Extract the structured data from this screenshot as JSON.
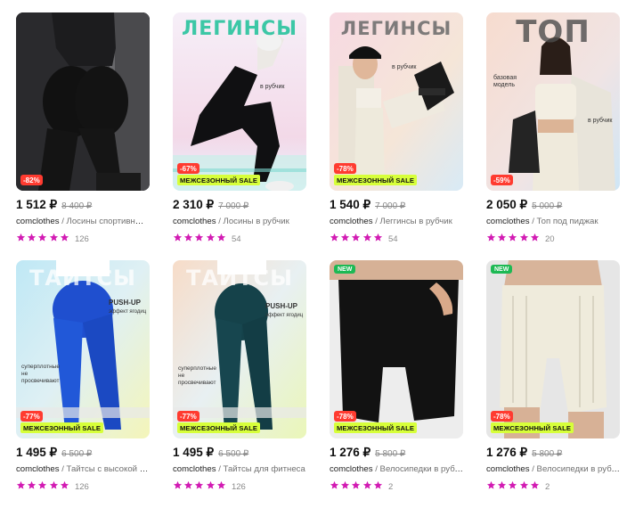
{
  "currency": "₽",
  "colors": {
    "accent_star": "#d21bb3",
    "discount_badge": "#ff3b30",
    "sale_badge": "#d7ff3a",
    "new_badge": "#1db954"
  },
  "products": [
    {
      "price": "1 512 ₽",
      "old_price": "8 400 ₽",
      "brand": "comclothes",
      "category": "Лосины спортивные т...",
      "reviews": "126",
      "discount": "-82%",
      "sale_label": "",
      "new_label": "",
      "banner_title": "",
      "banner_sub": "",
      "rating": 5
    },
    {
      "price": "2 310 ₽",
      "old_price": "7 000 ₽",
      "brand": "comclothes",
      "category": "Лосины в рубчик",
      "reviews": "54",
      "discount": "-67%",
      "sale_label": "МЕЖСЕЗОННЫЙ SALE",
      "new_label": "",
      "banner_title": "ЛЕГИНСЫ",
      "banner_sub": "в рубчик",
      "rating": 5
    },
    {
      "price": "1 540 ₽",
      "old_price": "7 000 ₽",
      "brand": "comclothes",
      "category": "Леггинсы в рубчик",
      "reviews": "54",
      "discount": "-78%",
      "sale_label": "МЕЖСЕЗОННЫЙ SALE",
      "new_label": "",
      "banner_title": "ЛЕГИНСЫ",
      "banner_sub": "в рубчик",
      "rating": 5
    },
    {
      "price": "2 050 ₽",
      "old_price": "5 000 ₽",
      "brand": "comclothes",
      "category": "Топ под пиджак",
      "reviews": "20",
      "discount": "-59%",
      "sale_label": "",
      "new_label": "",
      "banner_title": "ТОП",
      "banner_sub": "базовая модель",
      "banner_sub2": "в рубчик",
      "rating": 5
    },
    {
      "price": "1 495 ₽",
      "old_price": "6 500 ₽",
      "brand": "comclothes",
      "category": "Тайтсы с высокой тал...",
      "reviews": "126",
      "discount": "-77%",
      "sale_label": "МЕЖСЕЗОННЫЙ SALE",
      "new_label": "",
      "banner_title": "ТАЙТСЫ",
      "banner_sub": "PUSH-UP",
      "banner_sub2": "эффект ягодиц",
      "banner_sub3": "суперплотные не просвечивают",
      "rating": 5
    },
    {
      "price": "1 495 ₽",
      "old_price": "6 500 ₽",
      "brand": "comclothes",
      "category": "Тайтсы для фитнеса",
      "reviews": "126",
      "discount": "-77%",
      "sale_label": "МЕЖСЕЗОННЫЙ SALE",
      "new_label": "",
      "banner_title": "ТАЙТСЫ",
      "banner_sub": "PUSH-UP",
      "banner_sub2": "эффект ягодиц",
      "banner_sub3": "суперплотные не просвечивают",
      "rating": 5
    },
    {
      "price": "1 276 ₽",
      "old_price": "5 800 ₽",
      "brand": "comclothes",
      "category": "Велосипедки в рубчик...",
      "reviews": "2",
      "discount": "-78%",
      "sale_label": "МЕЖСЕЗОННЫЙ SALE",
      "new_label": "NEW",
      "banner_title": "",
      "banner_sub": "",
      "rating": 5
    },
    {
      "price": "1 276 ₽",
      "old_price": "5 800 ₽",
      "brand": "comclothes",
      "category": "Велосипедки в рубчик...",
      "reviews": "2",
      "discount": "-78%",
      "sale_label": "МЕЖСЕЗОННЫЙ SALE",
      "new_label": "NEW",
      "banner_title": "",
      "banner_sub": "",
      "rating": 5
    }
  ]
}
